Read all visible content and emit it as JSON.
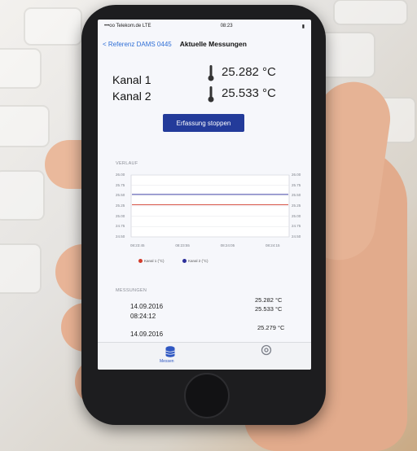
{
  "phone": {
    "status": {
      "carrier": "•••oo Telekom.de LTE",
      "time": "08:23",
      "battery": "▮"
    },
    "nav": {
      "back_label": "< Referenz DAMS 0445",
      "title": "Aktuelle Messungen"
    },
    "channels": [
      {
        "label": "Kanal 1",
        "value": "25.282 °C"
      },
      {
        "label": "Kanal 2",
        "value": "25.533 °C"
      }
    ],
    "stop_button": "Erfassung stoppen",
    "chart_section": "VERLAUF",
    "chart_data": {
      "type": "line",
      "ylim": [
        24.5,
        26.0
      ],
      "ylabels_left": [
        "26.00",
        "25.75",
        "25.50",
        "25.25",
        "25.00",
        "24.75",
        "24.50"
      ],
      "ylabels_right": [
        "26.00",
        "25.75",
        "25.50",
        "25.25",
        "25.00",
        "24.75",
        "24.50"
      ],
      "xlabels": [
        "08:23:45",
        "08:23:55",
        "08:24:05",
        "08:24:15"
      ],
      "series": [
        {
          "name": "Kanal 1 (°C)",
          "color": "#d23b2b",
          "values": [
            25.28,
            25.28,
            25.28,
            25.28
          ]
        },
        {
          "name": "Kanal 2 (°C)",
          "color": "#2c2f9a",
          "values": [
            25.53,
            25.53,
            25.53,
            25.53
          ]
        }
      ]
    },
    "measurements_section": "MESSUNGEN",
    "measurements": [
      {
        "date": "14.09.2016",
        "time": "08:24:12",
        "v1": "25.282 °C",
        "v2": "25.533 °C"
      },
      {
        "date": "14.09.2016",
        "time": "",
        "v1": "25.279 °C",
        "v2": ""
      }
    ],
    "tab": {
      "label": "Messen",
      "icon": "database-icon",
      "settings_icon": "gear-icon"
    },
    "accent": "#233b9a"
  }
}
